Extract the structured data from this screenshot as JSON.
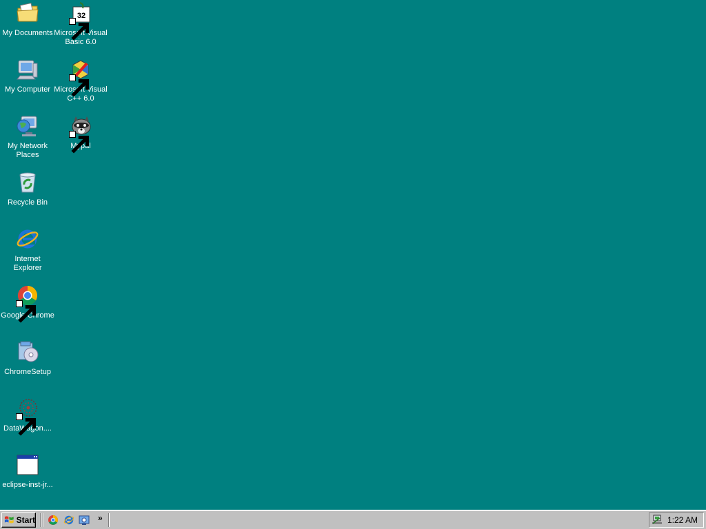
{
  "desktop": {
    "icons": [
      {
        "label": "My Documents",
        "icon": "folder-documents-icon"
      },
      {
        "label": "Microsoft Visual Basic 6.0",
        "icon": "visual-basic-icon"
      },
      {
        "label": "My Computer",
        "icon": "computer-icon"
      },
      {
        "label": "Microsoft Visual C++ 6.0",
        "icon": "visual-cpp-icon"
      },
      {
        "label": "My Network Places",
        "icon": "network-places-icon"
      },
      {
        "label": "Mypal",
        "icon": "mypal-raccoon-icon"
      },
      {
        "label": "Recycle Bin",
        "icon": "recycle-bin-icon"
      },
      {
        "label": "Internet Explorer",
        "icon": "internet-explorer-icon"
      },
      {
        "label": "Google Chrome",
        "icon": "chrome-icon"
      },
      {
        "label": "ChromeSetup",
        "icon": "installer-icon"
      },
      {
        "label": "DataWagon....",
        "icon": "datawagon-icon"
      },
      {
        "label": "eclipse-inst-jr...",
        "icon": "window-app-icon"
      }
    ],
    "background_color": "#008080"
  },
  "taskbar": {
    "start_label": "Start",
    "quick_launch": [
      "chrome-icon",
      "internet-explorer-icon",
      "show-desktop-icon"
    ],
    "overflow_label": "»",
    "clock": "1:22 AM"
  }
}
